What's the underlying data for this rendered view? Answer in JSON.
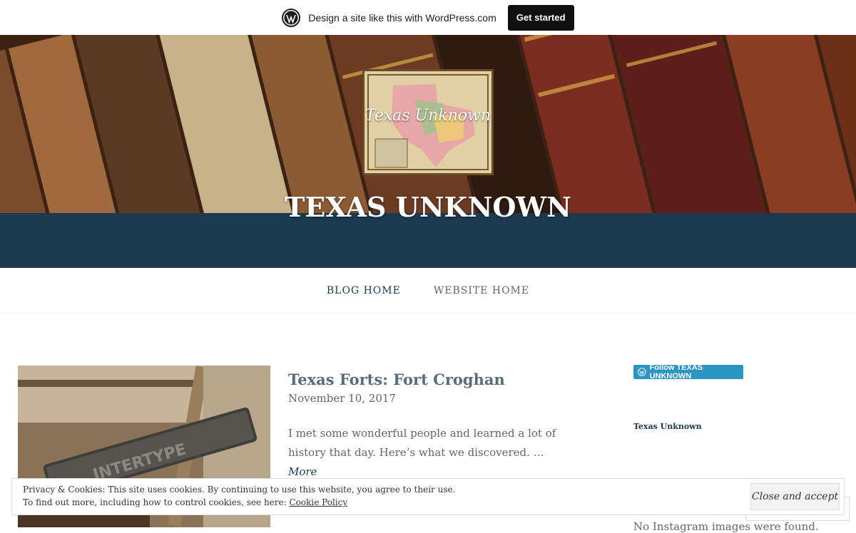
{
  "wpbar": {
    "text": "Design a site like this with WordPress.com",
    "button": "Get started"
  },
  "header": {
    "logo_text": "Texas Unknown",
    "site_title": "TEXAS UNKNOWN",
    "band_color": "#1b3a50"
  },
  "nav": {
    "items": [
      {
        "label": "BLOG HOME",
        "active": true
      },
      {
        "label": "WEBSITE HOME",
        "active": false
      }
    ]
  },
  "post": {
    "title": "Texas Forts: Fort Croghan",
    "date": "November 10, 2017",
    "excerpt": "I met some wonderful people and learned a lot of history that day. Here’s what we discovered. … ",
    "more": "More",
    "thumb_stamp": "INTERTYPE"
  },
  "sidebar": {
    "follow_button": "Follow TEXAS UNKNOWN",
    "widget_title": "Texas Unknown",
    "partial_text": "No Instagram images were found."
  },
  "cookie": {
    "line1": "Privacy & Cookies: This site uses cookies. By continuing to use this website, you agree to their use.",
    "line2_prefix": "To find out more, including how to control cookies, see here: ",
    "policy_link": "Cookie Policy",
    "accept": "Close and accept"
  }
}
